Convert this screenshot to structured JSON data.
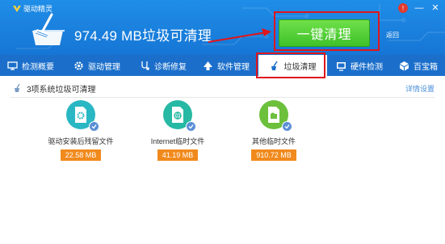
{
  "app": {
    "title": "驱动精灵"
  },
  "header": {
    "trash_size": "974.49 MB垃圾可清理",
    "clean_button": "一键清理",
    "back_link": "返回",
    "window_controls": {
      "notify": "!",
      "minimize": "—",
      "close": "✕"
    }
  },
  "tabs": [
    {
      "label": "检测概要",
      "icon": "monitor-icon"
    },
    {
      "label": "驱动管理",
      "icon": "gear-icon"
    },
    {
      "label": "诊断修复",
      "icon": "stethoscope-icon"
    },
    {
      "label": "软件管理",
      "icon": "arrow-up-icon"
    },
    {
      "label": "垃圾清理",
      "icon": "broom-icon",
      "active": true
    },
    {
      "label": "硬件检测",
      "icon": "screen-icon"
    },
    {
      "label": "百宝箱",
      "icon": "box-icon"
    }
  ],
  "summary": {
    "text": "3项系统垃圾可清理",
    "detail_link": "详情设置"
  },
  "items": [
    {
      "label": "驱动安装后残留文件",
      "size": "22.58 MB",
      "icon": "gear-doc-icon",
      "color": "#2ab7c4"
    },
    {
      "label": "Internet临时文件",
      "size": "41.19 MB",
      "icon": "globe-doc-icon",
      "color": "#27b9a4"
    },
    {
      "label": "其他临时文件",
      "size": "910.72 MB",
      "icon": "folder-doc-icon",
      "color": "#6cc03c"
    }
  ],
  "colors": {
    "header_blue": "#1a7fdc",
    "tab_blue": "#1b6fcb",
    "green_button": "#4cc92e",
    "orange_size": "#f18a1d",
    "highlight_red": "#e0151b"
  }
}
